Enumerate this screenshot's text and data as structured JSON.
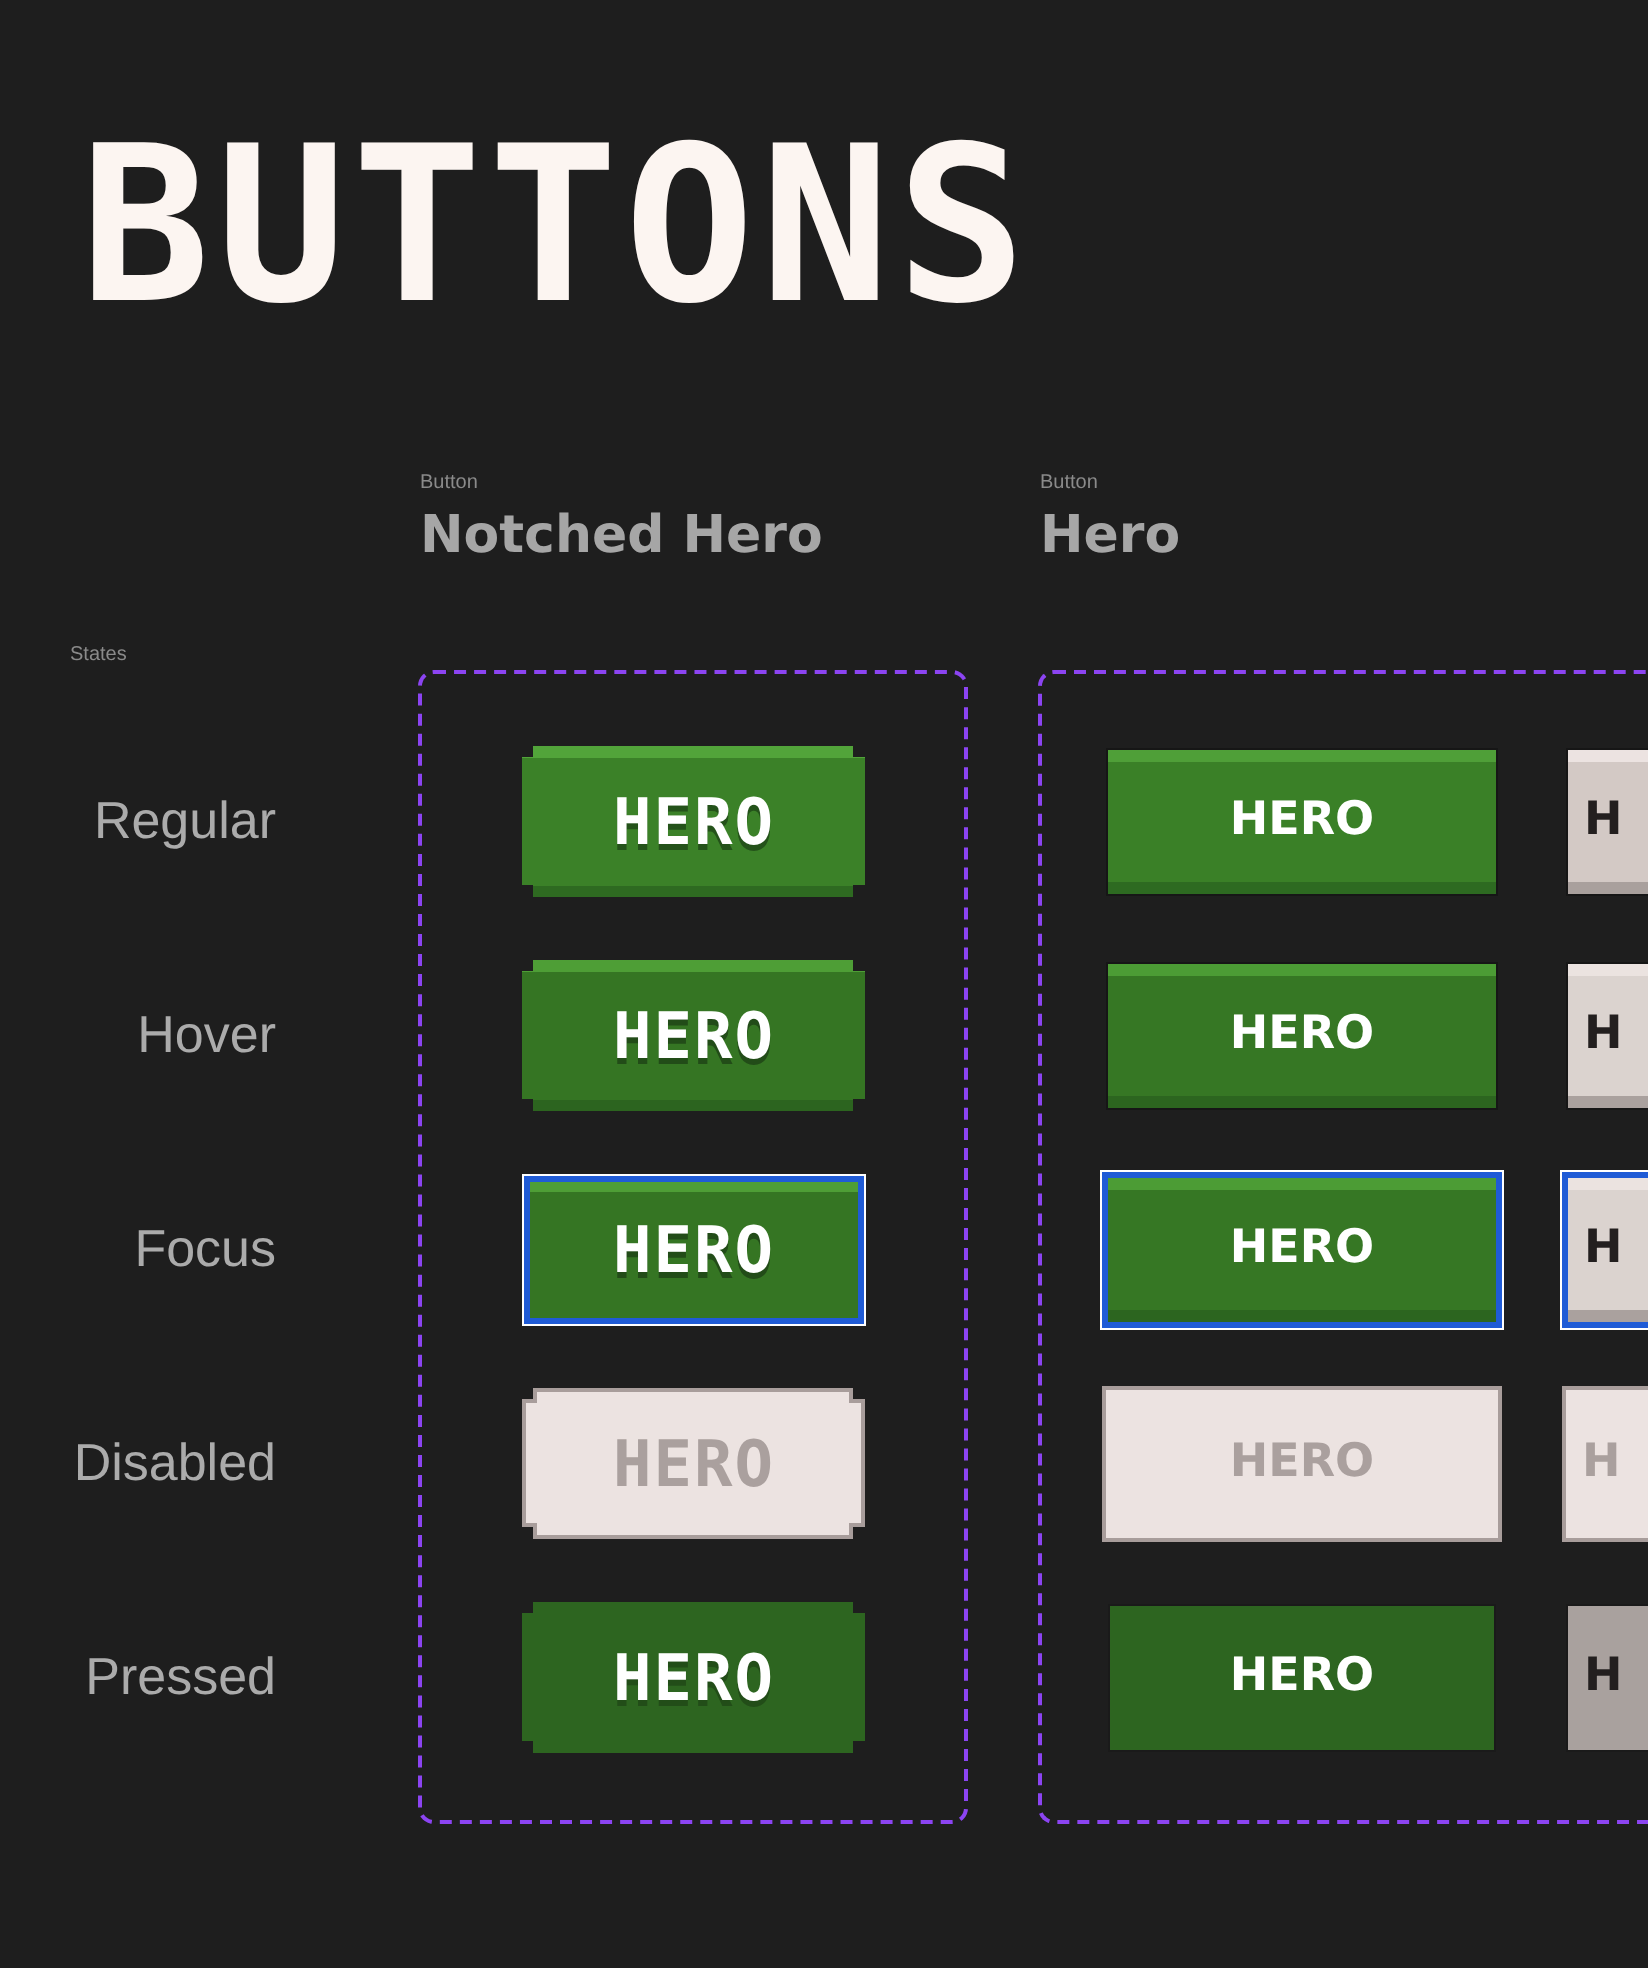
{
  "page_title": "BUTTONS",
  "states_label": "States",
  "rows": [
    {
      "label": "Regular"
    },
    {
      "label": "Hover"
    },
    {
      "label": "Focus"
    },
    {
      "label": "Disabled"
    },
    {
      "label": "Pressed"
    }
  ],
  "components": [
    {
      "category": "Button",
      "name": "Notched Hero",
      "kind": "notched",
      "columns": [
        {
          "kind": "primary",
          "buttons": [
            {
              "label": "HERO",
              "kind": "regular"
            },
            {
              "label": "HERO",
              "kind": "hover"
            },
            {
              "label": "HERO",
              "kind": "focus"
            },
            {
              "label": "HERO",
              "kind": "disabled"
            },
            {
              "label": "HERO",
              "kind": "pressed"
            }
          ]
        }
      ]
    },
    {
      "category": "Button",
      "name": "Hero",
      "kind": "hero",
      "columns": [
        {
          "kind": "primary",
          "buttons": [
            {
              "label": "HERO",
              "kind": "regular"
            },
            {
              "label": "HERO",
              "kind": "hover"
            },
            {
              "label": "HERO",
              "kind": "focus"
            },
            {
              "label": "HERO",
              "kind": "disabled"
            },
            {
              "label": "HERO",
              "kind": "pressed"
            }
          ]
        },
        {
          "kind": "secondary",
          "buttons": [
            {
              "label": "H",
              "kind": "regular"
            },
            {
              "label": "H",
              "kind": "hover"
            },
            {
              "label": "H",
              "kind": "focus"
            },
            {
              "label": "H",
              "kind": "disabled"
            },
            {
              "label": "H",
              "kind": "pressed"
            }
          ]
        }
      ]
    }
  ]
}
